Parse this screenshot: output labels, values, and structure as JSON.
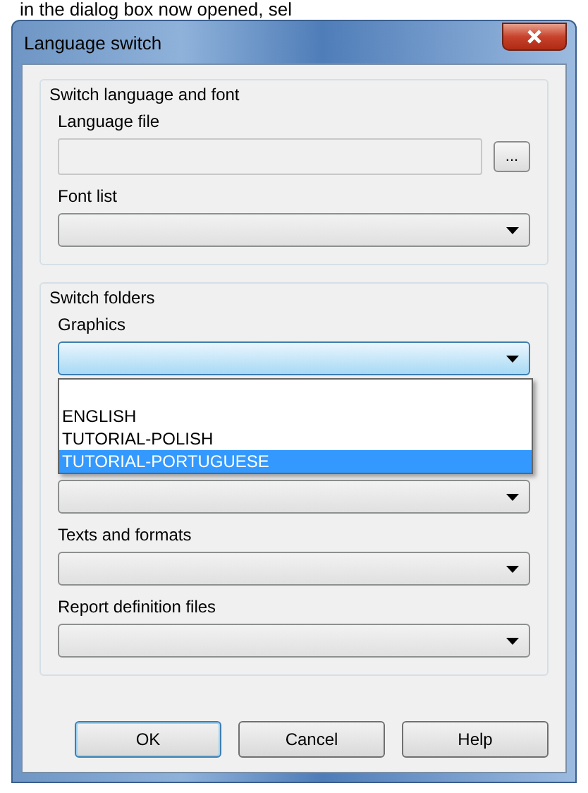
{
  "caption": "in the dialog box now opened, sel",
  "window": {
    "title": "Language switch"
  },
  "groups": [
    {
      "title": "Switch language and font",
      "fields": [
        {
          "kind": "file",
          "label": "Language file",
          "button": "..."
        },
        {
          "kind": "select",
          "label": "Font list",
          "focused": false
        }
      ]
    },
    {
      "title": "Switch folders",
      "fields": [
        {
          "kind": "select",
          "label": "Graphics",
          "focused": true,
          "open": true,
          "options": [
            {
              "label": "ENGLISH",
              "selected": false
            },
            {
              "label": "TUTORIAL-POLISH",
              "selected": false
            },
            {
              "label": "TUTORIAL-PORTUGUESE",
              "selected": true
            }
          ]
        },
        {
          "kind": "select",
          "focused": false
        },
        {
          "kind": "select",
          "label": "Texts and formats",
          "focused": false
        },
        {
          "kind": "select",
          "label": "Report definition files",
          "focused": false
        }
      ]
    }
  ],
  "buttons": [
    {
      "label": "OK",
      "default": true
    },
    {
      "label": "Cancel",
      "default": false
    },
    {
      "label": "Help",
      "default": false
    }
  ]
}
